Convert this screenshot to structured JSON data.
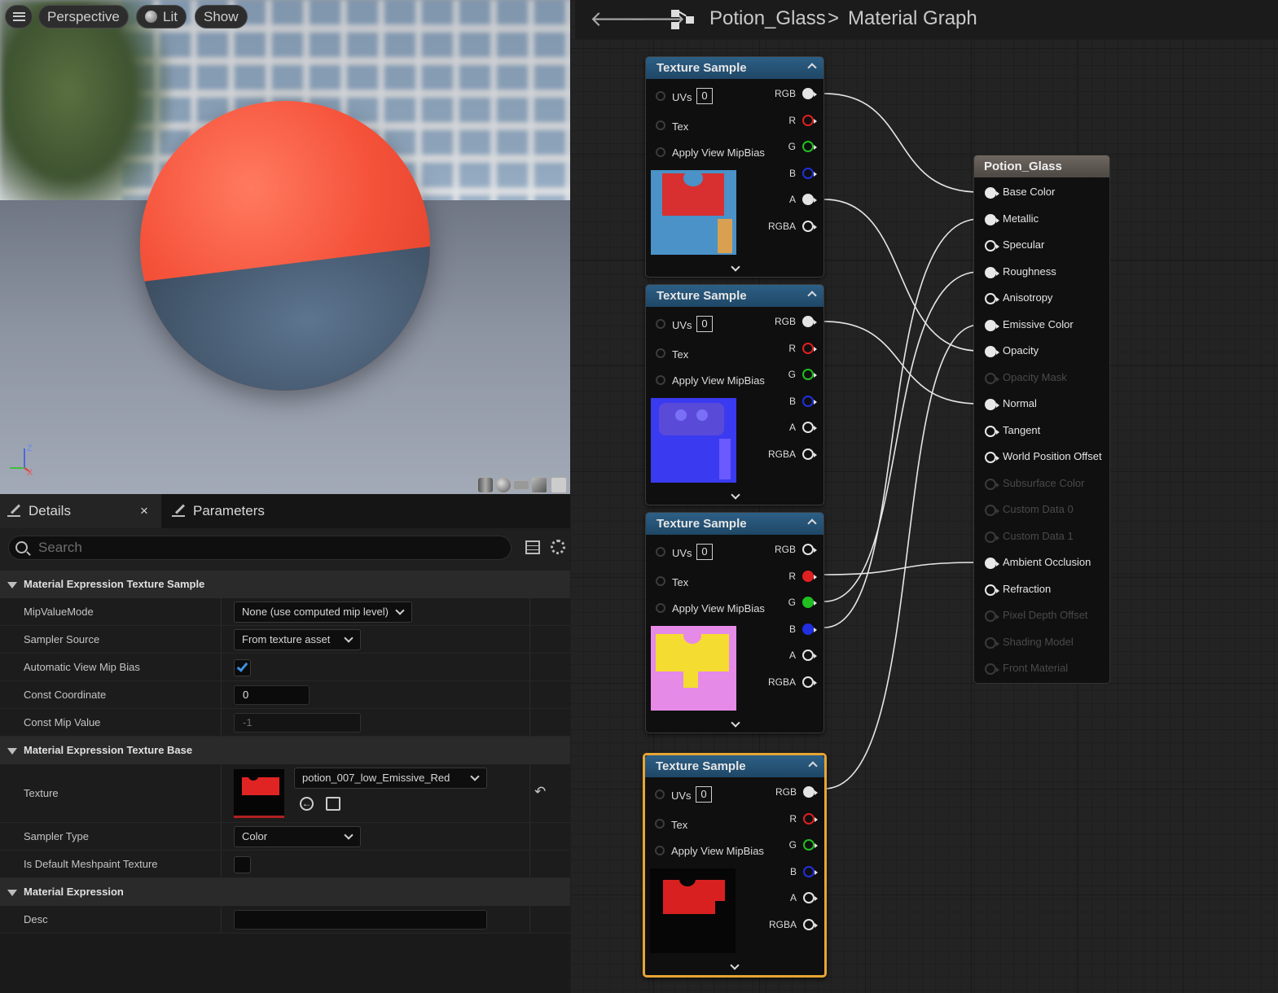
{
  "viewport": {
    "buttons": {
      "perspective": "Perspective",
      "lit": "Lit",
      "show": "Show"
    },
    "axis": {
      "z": "Z",
      "x": "X"
    }
  },
  "details": {
    "tabs": [
      {
        "label": "Details"
      },
      {
        "label": "Parameters"
      }
    ],
    "search_placeholder": "Search",
    "sections": {
      "texture_sample": "Material Expression Texture Sample",
      "texture_base": "Material Expression Texture Base",
      "expression": "Material Expression"
    },
    "props": {
      "mip_value_mode": {
        "label": "MipValueMode",
        "value": "None (use computed mip level)"
      },
      "sampler_source": {
        "label": "Sampler Source",
        "value": "From texture asset"
      },
      "auto_view_mip_bias": {
        "label": "Automatic View Mip Bias",
        "checked": true
      },
      "const_coordinate": {
        "label": "Const Coordinate",
        "value": "0"
      },
      "const_mip_value": {
        "label": "Const Mip Value",
        "value": "-1"
      },
      "texture": {
        "label": "Texture",
        "value": "potion_007_low_Emissive_Red"
      },
      "sampler_type": {
        "label": "Sampler Type",
        "value": "Color"
      },
      "default_meshpaint": {
        "label": "Is Default Meshpaint Texture",
        "checked": false
      },
      "desc": {
        "label": "Desc",
        "value": ""
      }
    }
  },
  "graph": {
    "breadcrumb": {
      "asset": "Potion_Glass",
      "separator": ">",
      "graph": "Material Graph"
    },
    "node_title": "Texture Sample",
    "inputs": {
      "uvs": "UVs",
      "uv_index": "0",
      "tex": "Tex",
      "mipbias": "Apply View MipBias"
    },
    "outputs": [
      "RGB",
      "R",
      "G",
      "B",
      "A",
      "RGBA"
    ],
    "result": {
      "title": "Potion_Glass",
      "pins": [
        {
          "label": "Base Color",
          "active": true
        },
        {
          "label": "Metallic",
          "active": true
        },
        {
          "label": "Specular",
          "active": true
        },
        {
          "label": "Roughness",
          "active": true
        },
        {
          "label": "Anisotropy",
          "active": true
        },
        {
          "label": "Emissive Color",
          "active": true
        },
        {
          "label": "Opacity",
          "active": true
        },
        {
          "label": "Opacity Mask",
          "active": false
        },
        {
          "label": "Normal",
          "active": true
        },
        {
          "label": "Tangent",
          "active": true
        },
        {
          "label": "World Position Offset",
          "active": true
        },
        {
          "label": "Subsurface Color",
          "active": false
        },
        {
          "label": "Custom Data 0",
          "active": false
        },
        {
          "label": "Custom Data 1",
          "active": false
        },
        {
          "label": "Ambient Occlusion",
          "active": true
        },
        {
          "label": "Refraction",
          "active": true
        },
        {
          "label": "Pixel Depth Offset",
          "active": false
        },
        {
          "label": "Shading Model",
          "active": false
        },
        {
          "label": "Front Material",
          "active": false
        }
      ]
    },
    "colors": {
      "selected_outline": "#e8a534",
      "node_header": "#2d5f86",
      "r_pin": "#e02020",
      "g_pin": "#20c020",
      "b_pin": "#2030e0"
    }
  }
}
